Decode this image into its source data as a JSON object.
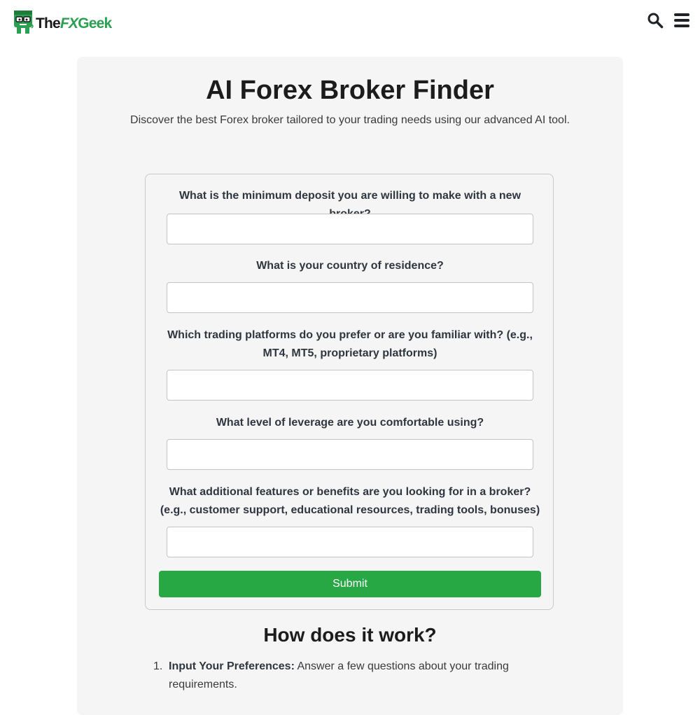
{
  "header": {
    "logo": {
      "part1": "The",
      "part2": "FX",
      "part3": "Geek"
    },
    "icons": {
      "search": "search-icon",
      "menu": "hamburger-menu-icon"
    }
  },
  "main": {
    "title": "AI Forex Broker Finder",
    "subtitle": "Discover the best Forex broker tailored to your trading needs using our advanced AI tool."
  },
  "form": {
    "questions": [
      {
        "label": "What is the minimum deposit you are willing to make with a new broker?",
        "value": ""
      },
      {
        "label": "What is your country of residence?",
        "value": ""
      },
      {
        "label": "Which trading platforms do you prefer or are you familiar with? (e.g., MT4, MT5, proprietary platforms)",
        "value": ""
      },
      {
        "label": "What level of leverage are you comfortable using?",
        "value": ""
      },
      {
        "label": "What additional features or benefits are you looking for in a broker? (e.g., customer support, educational resources, trading tools, bonuses)",
        "value": ""
      }
    ],
    "submit_label": "Submit"
  },
  "how_it_works": {
    "title": "How does it work?",
    "steps": [
      {
        "num": "1.",
        "title": "Input Your Preferences:",
        "text": " Answer a few questions about your trading requirements."
      }
    ]
  },
  "colors": {
    "accent": "#28a745",
    "brand_green": "#2aa050",
    "card_bg": "#f5f5f5"
  }
}
